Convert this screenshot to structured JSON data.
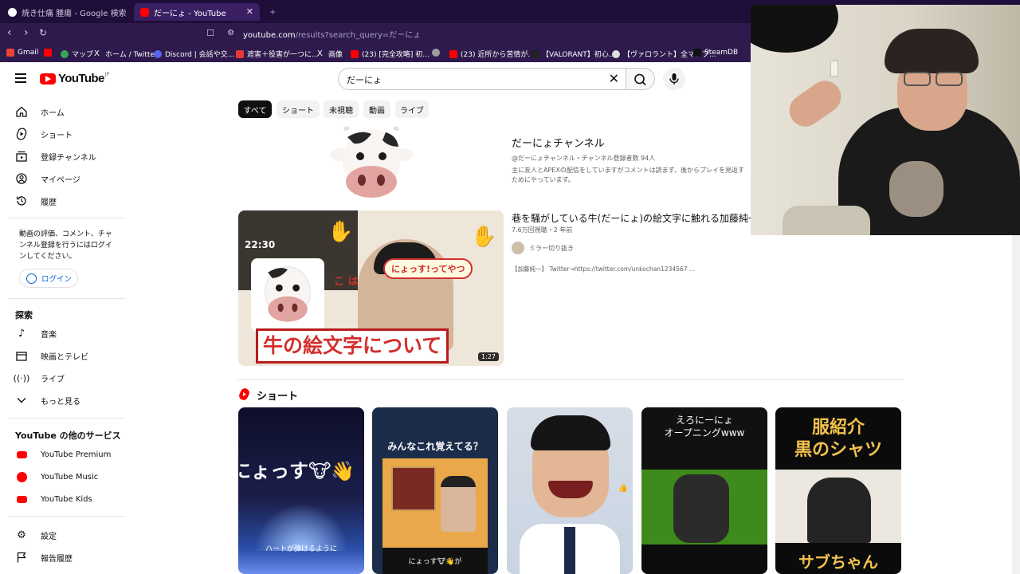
{
  "browser": {
    "tabs": [
      {
        "title": "焼き仕痛 腫瘍 - Google 検索",
        "active": false
      },
      {
        "title": "だーにょ - YouTube",
        "active": true
      }
    ],
    "new_tab": "+",
    "url": "youtube.com",
    "url_rest": "/results?search_query=だーにょ",
    "bookmarks": [
      "Gmail",
      "マップ",
      "ホーム / Twitter",
      "Discord | 会話や交...",
      "遮害＋役害が一つに...",
      "画像",
      "(23) [完全攻略] 初...",
      "(23) 近所から苦情が...",
      "【VALORANT】初心...",
      "【ヴァロラント】全マップ...",
      "SteamDB"
    ]
  },
  "header": {
    "logo_text": "YouTube",
    "logo_region": "JP",
    "search_value": "だーにょ"
  },
  "sidebar": {
    "items": [
      {
        "label": "ホーム",
        "icon": "home-icon"
      },
      {
        "label": "ショート",
        "icon": "shorts-icon"
      },
      {
        "label": "登録チャンネル",
        "icon": "subscriptions-icon"
      },
      {
        "label": "マイページ",
        "icon": "my-page-icon"
      },
      {
        "label": "履歴",
        "icon": "history-icon"
      }
    ],
    "login_note": "動画の評価、コメント、チャンネル登録を行うにはログインしてください。",
    "login_button": "ログイン",
    "explore_heading": "探索",
    "explore": [
      {
        "label": "音楽",
        "icon": "music-icon"
      },
      {
        "label": "映画とテレビ",
        "icon": "movies-icon"
      },
      {
        "label": "ライブ",
        "icon": "live-icon"
      },
      {
        "label": "もっと見る",
        "icon": "chevron-down-icon"
      }
    ],
    "services_heading": "YouTube の他のサービス",
    "services": [
      {
        "label": "YouTube Premium"
      },
      {
        "label": "YouTube Music"
      },
      {
        "label": "YouTube Kids"
      }
    ],
    "footer": [
      {
        "label": "設定",
        "icon": "settings-icon"
      },
      {
        "label": "報告履歴",
        "icon": "flag-icon"
      }
    ]
  },
  "chips": [
    "すべて",
    "ショート",
    "未視聴",
    "動画",
    "ライブ"
  ],
  "channel": {
    "name": "だーにょチャンネル",
    "meta": "@だーにょチャンネル・チャンネル登録者数 94人",
    "description": "主に友人とAPEXの配信をしていますがコメントは読まず、後からプレイを見返すためにやっています。"
  },
  "video": {
    "title": "巷を騒がしている牛(だーにょ)の絵文字に触れる加藤純一",
    "meta": "7.6万回視聴・2 年前",
    "channel": "ミラー切り抜き",
    "description": "【加藤純一】 Twitter→https://twitter.com/unkochan1234567 ...",
    "duration": "1:27",
    "thumb_caption": "牛の絵文字について",
    "thumb_bubble": "にょっす!ってやつ",
    "thumb_time": "22:30",
    "thumb_red": "こ は"
  },
  "shorts": {
    "heading": "ショート",
    "items": [
      {
        "top": "にょっす🐮👋",
        "bottom": "ハートが弾けるように"
      },
      {
        "top": "みんなこれ覚えてる？",
        "bottom": "にょっす🐮👋が"
      },
      {
        "top": "",
        "bottom": ""
      },
      {
        "top": "えろにーにょ\nオープニングwww",
        "bottom": ""
      },
      {
        "top": "服紹介\n黒のシャツ",
        "bottom": "サブちゃん"
      }
    ]
  },
  "colors": {
    "accent": "#ff0000",
    "link": "#065fd4",
    "tabbar": "#1f0d3a",
    "toolbar": "#2e1a4d"
  }
}
